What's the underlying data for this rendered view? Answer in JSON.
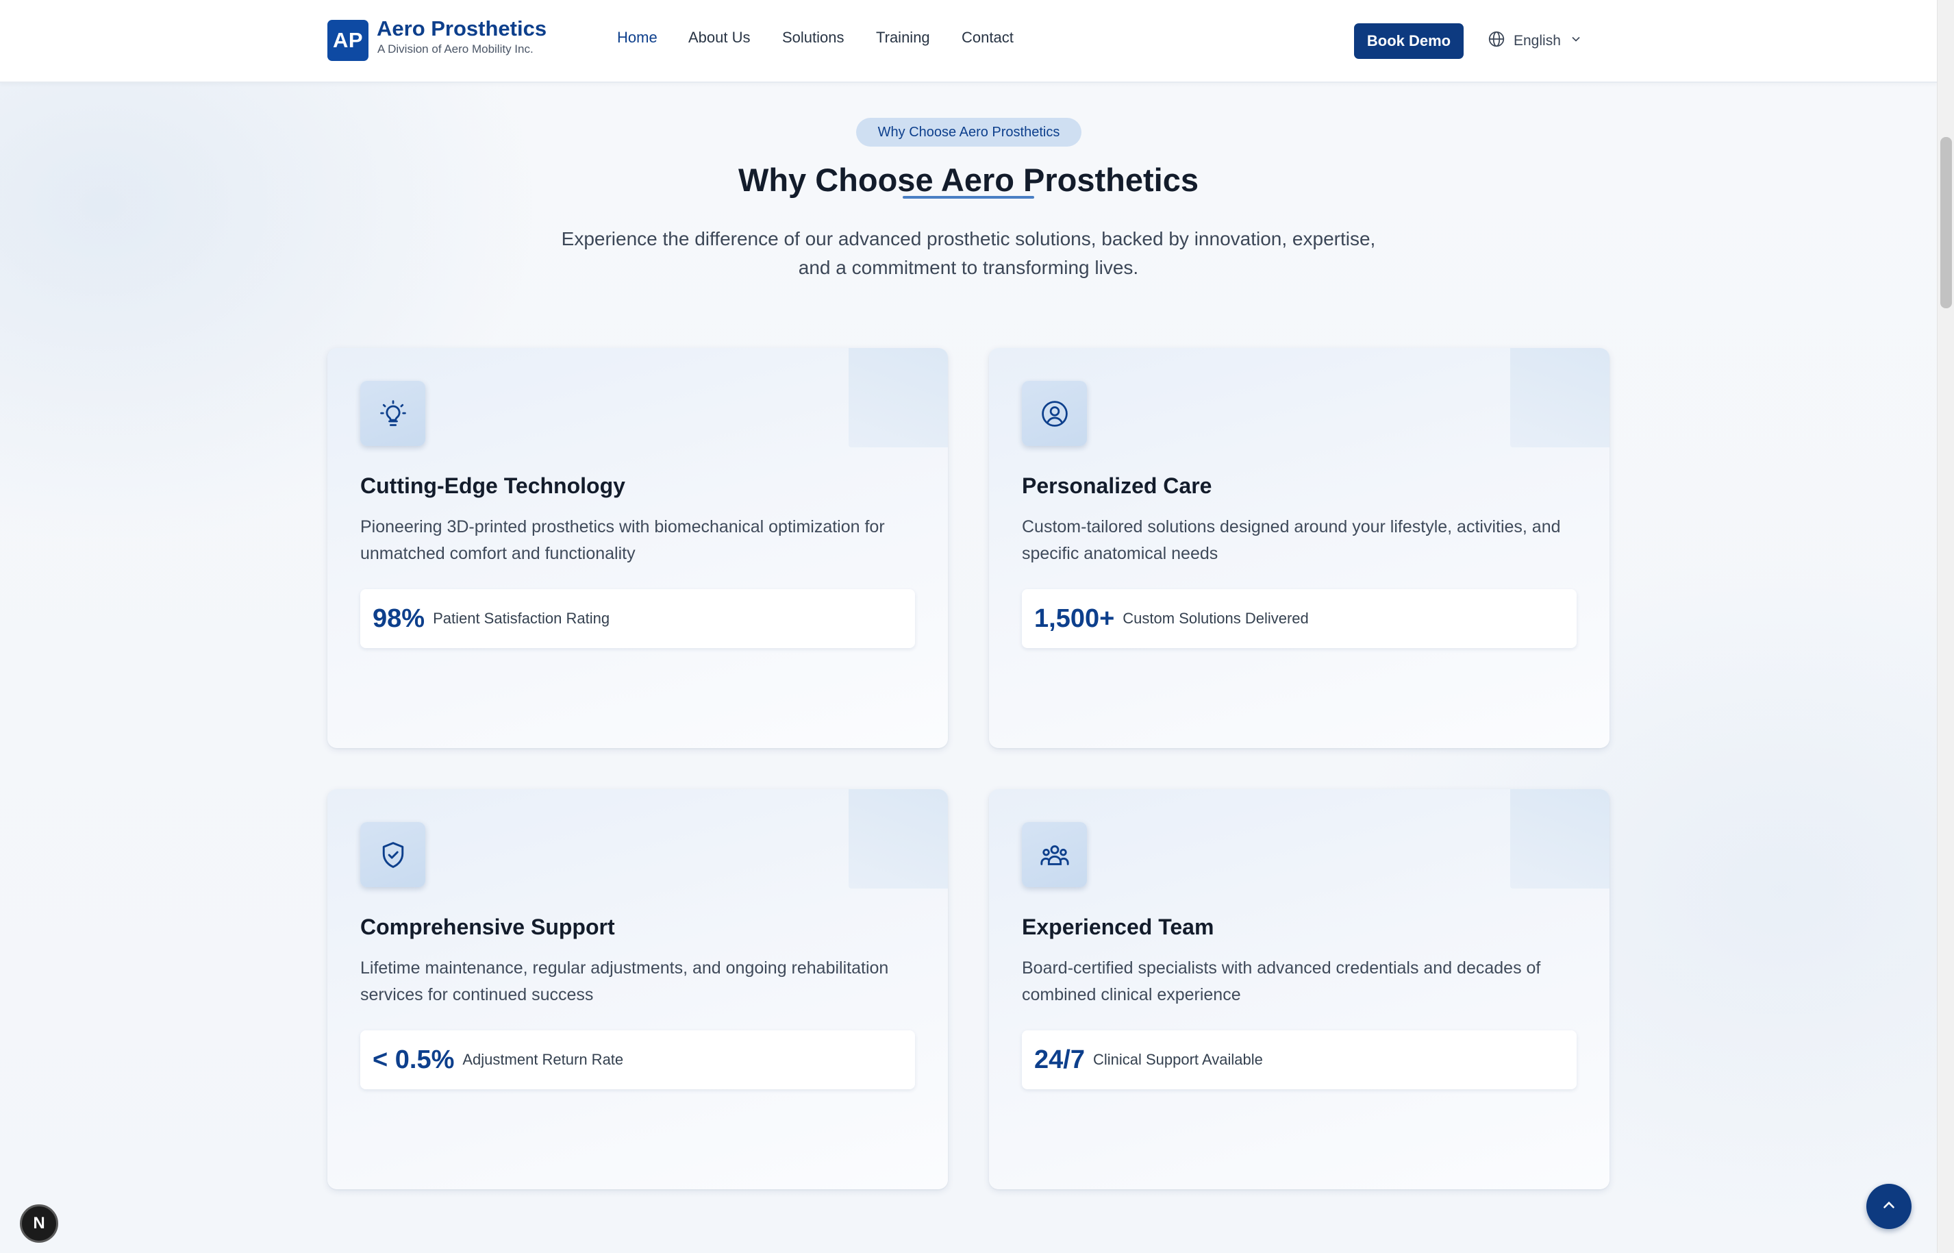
{
  "brand": {
    "logo_text": "AP",
    "name": "Aero Prosthetics",
    "subtitle": "A Division of Aero Mobility Inc."
  },
  "nav": {
    "items": [
      {
        "label": "Home",
        "active": true
      },
      {
        "label": "About Us"
      },
      {
        "label": "Solutions"
      },
      {
        "label": "Training"
      },
      {
        "label": "Contact"
      }
    ]
  },
  "header": {
    "cta_label": "Book Demo",
    "language": "English"
  },
  "section": {
    "pill": "Why Choose Aero Prosthetics",
    "title": "Why Choose Aero Prosthetics",
    "subtitle_line1": "Experience the difference of our advanced prosthetic solutions, backed by innovation, expertise,",
    "subtitle_line2": "and a commitment to transforming lives."
  },
  "cards": [
    {
      "icon": "lightbulb-icon",
      "title": "Cutting-Edge Technology",
      "desc_line1": "Pioneering 3D-printed prosthetics with biomechanical optimization for",
      "desc_line2": "unmatched comfort and functionality",
      "stat_value": "98%",
      "stat_label": "Patient Satisfaction Rating"
    },
    {
      "icon": "user-circle-icon",
      "title": "Personalized Care",
      "desc_line1": "Custom-tailored solutions designed around your lifestyle, activities, and",
      "desc_line2": "specific anatomical needs",
      "stat_value": "1,500+",
      "stat_label": "Custom Solutions Delivered"
    },
    {
      "icon": "shield-check-icon",
      "title": "Comprehensive Support",
      "desc_line1": "Lifetime maintenance, regular adjustments, and ongoing rehabilitation",
      "desc_line2": "services for continued success",
      "stat_value": "< 0.5%",
      "stat_label": "Adjustment Return Rate"
    },
    {
      "icon": "team-icon",
      "title": "Experienced Team",
      "desc_line1": "Board-certified specialists with advanced credentials and decades of",
      "desc_line2": "combined clinical experience",
      "stat_value": "24/7",
      "stat_label": "Clinical Support Available"
    }
  ],
  "floating": {
    "dev_badge": "N"
  },
  "colors": {
    "brand_primary": "#0d3f8c",
    "button_bg": "#0d3a80",
    "pill_bg": "#cfdff2"
  }
}
